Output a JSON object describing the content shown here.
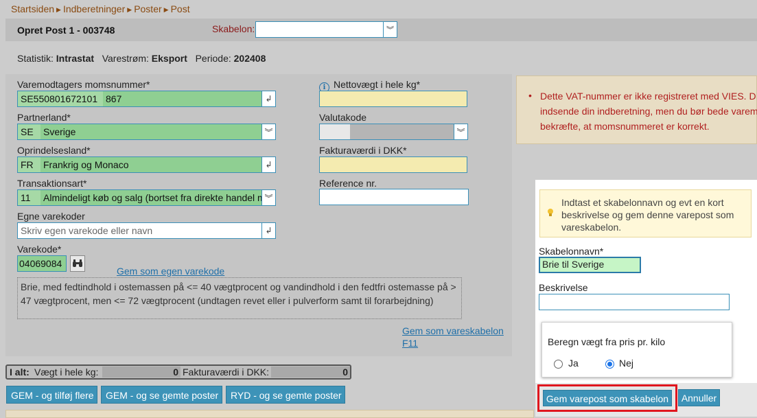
{
  "breadcrumb": [
    "Startsiden",
    "Indberetninger",
    "Poster",
    "Post"
  ],
  "header": {
    "title": "Opret Post 1 - 003748",
    "skabelon_label": "Skabelon:",
    "skabelon_value": ""
  },
  "info": {
    "statistik_label": "Statistik:",
    "statistik_value": "Intrastat",
    "varestrom_label": "Varestrøm:",
    "varestrom_value": "Eksport",
    "periode_label": "Periode:",
    "periode_value": "202408"
  },
  "form": {
    "momsnummer_label": "Varemodtagers momsnummer*",
    "momsnummer_code": "SE550801672101",
    "momsnummer_name": "867",
    "partnerland_label": "Partnerland*",
    "partnerland_code": "SE",
    "partnerland_name": "Sverige",
    "oprindelsesland_label": "Oprindelsesland*",
    "oprindelsesland_code": "FR",
    "oprindelsesland_name": "Frankrig og Monaco",
    "transaktionsart_label": "Transaktionsart*",
    "transaktionsart_code": "11",
    "transaktionsart_name": "Almindeligt køb og salg (bortset fra direkte handel m",
    "egne_label": "Egne varekoder",
    "egne_placeholder": "Skriv egen varekode eller navn",
    "varekode_label": "Varekode*",
    "varekode_value": "04069084",
    "gem_egen_link": "Gem som egen varekode",
    "description": "Brie, med fedtindhold i ostemassen på <= 40 vægtprocent og vandindhold i den fedtfri ostemasse på > 47 vægtprocent, men <= 72 vægtprocent (undtagen revet eller i pulverform samt til forarbejdning)",
    "netto_label": "Nettovægt i hele kg*",
    "valuta_label": "Valutakode",
    "faktura_label": "Fakturaværdi i DKK*",
    "reference_label": "Reference nr.",
    "gem_vareskabelon_link": "Gem som vareskabelon",
    "f11": "F11"
  },
  "warning": {
    "bullet": "•",
    "lines": [
      "Dette VAT-nummer er ikke registreret med VIES. D",
      "indsende din indberetning, men du bør bede varem",
      "bekræfte, at momsnummeret er korrekt."
    ]
  },
  "totals": {
    "label": "I alt:",
    "weight_label": "Vægt i hele kg:",
    "weight_value": "0",
    "value_label": "Fakturaværdi i DKK:",
    "value_value": "0"
  },
  "buttons": {
    "gem_tilfoj": "GEM - og tilføj flere",
    "gem_se": "GEM - og se gemte poster",
    "ryd": "RYD - og se gemte poster"
  },
  "dialog": {
    "tip_lines": [
      "Indtast et skabelonnavn og evt en kort",
      "beskrivelse og gem denne varepost som",
      "vareskabelon."
    ],
    "name_label": "Skabelonnavn*",
    "name_value": "Brie til Sverige",
    "desc_label": "Beskrivelse",
    "desc_value": "",
    "group_label": "Beregn vægt fra pris pr. kilo",
    "radio_ja": "Ja",
    "radio_nej": "Nej",
    "selected": "Nej",
    "save_button": "Gem varepost som skabelon",
    "cancel_button": "Annuller"
  },
  "colors": {
    "accent": "#3d93b8",
    "highlight": "#e0161e",
    "warning_text": "#b01f1f",
    "breadcrumb": "#8a4b12"
  }
}
